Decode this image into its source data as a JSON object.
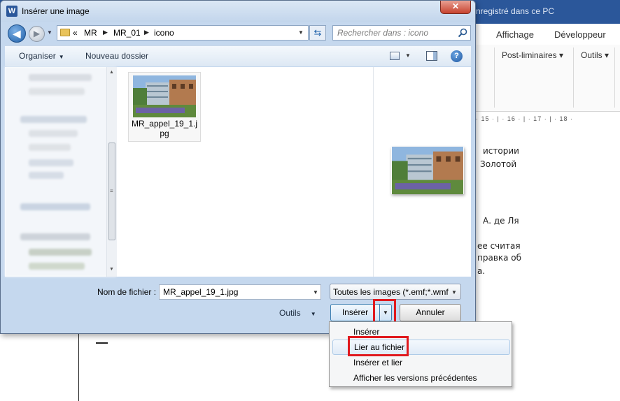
{
  "word": {
    "title_fragment": "nregistré dans ce PC",
    "tabs": [
      {
        "label": "Affichage"
      },
      {
        "label": "Développeur"
      }
    ],
    "ribbon": [
      {
        "label": "Post-liminaires ▾"
      },
      {
        "label": "Outils ▾"
      }
    ],
    "ruler": "· 15 · | · 16 · | · 17 · | · 18 ·",
    "doc_lines": [
      "истории",
      "Золотой",
      "А. де Ля",
      "ее  считая",
      "правка об",
      "а."
    ]
  },
  "dialog": {
    "title": "Insérer une image",
    "app_icon": "W",
    "close_label": "✕",
    "breadcrumb": {
      "overflow": "«",
      "items": [
        {
          "label": "MR"
        },
        {
          "label": "MR_01"
        },
        {
          "label": "icono"
        }
      ]
    },
    "search": {
      "placeholder": "Rechercher dans : icono"
    },
    "toolbar": {
      "organize": "Organiser",
      "new_folder": "Nouveau dossier"
    },
    "file": {
      "name": "MR_appel_19_1.jpg"
    },
    "filename_label": "Nom de fichier :",
    "filename_value": "MR_appel_19_1.jpg",
    "file_type": "Toutes les images (*.emf;*.wmf",
    "tools": "Outils",
    "insert_label": "Insérer",
    "cancel_label": "Annuler",
    "menu": [
      {
        "label": "Insérer"
      },
      {
        "label": "Lier au fichier"
      },
      {
        "label": "Insérer et lier"
      },
      {
        "label": "Afficher les versions précédentes"
      }
    ]
  },
  "icons": [
    "back-arrow-icon",
    "forward-arrow-icon",
    "folder-icon",
    "refresh-icon",
    "search-icon",
    "view-icon",
    "preview-pane-icon",
    "help-icon"
  ],
  "colors": {
    "word_blue": "#2b579a",
    "highlight_red": "#e0191e",
    "dialog_frame": "#c5d8ee"
  }
}
